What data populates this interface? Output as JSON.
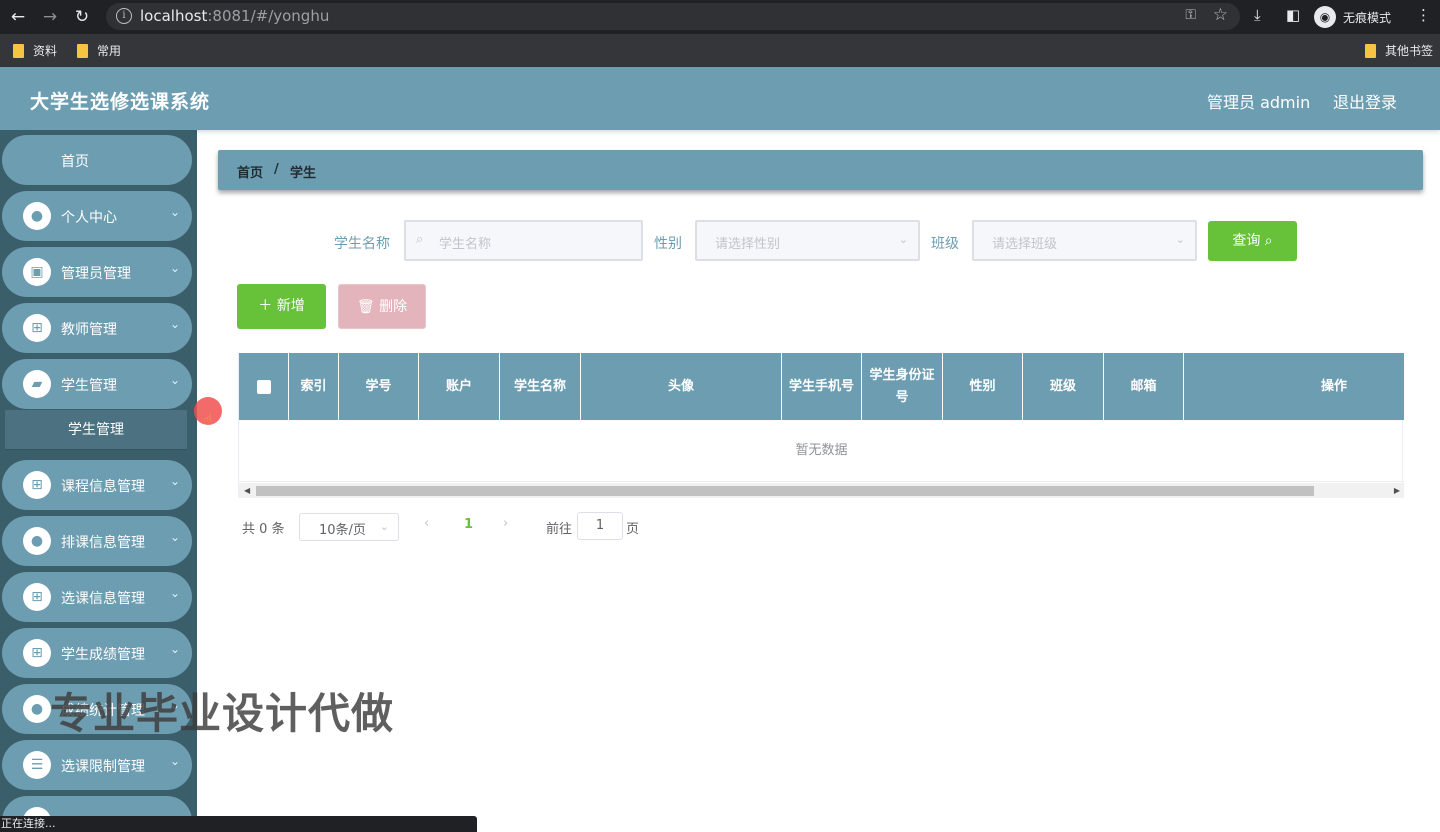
{
  "browser": {
    "url_host": "localhost",
    "url_rest": ":8081/#/yonghu",
    "incognito_label": "无痕模式",
    "bookmarks": [
      "资料",
      "常用"
    ],
    "other_bookmarks": "其他书签",
    "status_text": "正在连接..."
  },
  "header": {
    "title": "大学生选修选课系统",
    "admin_label": "管理员 admin",
    "logout_label": "退出登录"
  },
  "sidebar": {
    "home": "首页",
    "items": [
      {
        "label": "个人中心",
        "icon": "user-icon"
      },
      {
        "label": "管理员管理",
        "icon": "clipboard-icon"
      },
      {
        "label": "教师管理",
        "icon": "grid-icon"
      },
      {
        "label": "学生管理",
        "icon": "wallet-icon"
      },
      {
        "label": "课程信息管理",
        "icon": "grid-icon"
      },
      {
        "label": "排课信息管理",
        "icon": "user-icon"
      },
      {
        "label": "选课信息管理",
        "icon": "grid-icon"
      },
      {
        "label": "学生成绩管理",
        "icon": "grid-icon"
      },
      {
        "label": "成绩统计管理",
        "icon": "bulb-icon"
      },
      {
        "label": "选课限制管理",
        "icon": "list-icon"
      }
    ],
    "submenu_label": "学生管理"
  },
  "breadcrumb": {
    "home": "首页",
    "separator": "/",
    "current": "学生"
  },
  "filters": {
    "name_label": "学生名称",
    "name_placeholder": "学生名称",
    "gender_label": "性别",
    "gender_placeholder": "请选择性别",
    "class_label": "班级",
    "class_placeholder": "请选择班级",
    "query_label": "查询"
  },
  "actions": {
    "add_label": "新增",
    "delete_label": "删除"
  },
  "table": {
    "columns": [
      "索引",
      "学号",
      "账户",
      "学生名称",
      "头像",
      "学生手机号",
      "学生身份证号",
      "性别",
      "班级",
      "邮箱",
      "操作"
    ],
    "empty_text": "暂无数据"
  },
  "pagination": {
    "total_text": "共 0 条",
    "page_size": "10条/页",
    "current_page": "1",
    "goto_label": "前往",
    "goto_value": "1",
    "page_suffix": "页"
  },
  "watermark": "专业毕业设计代做",
  "colors": {
    "primary": "#6d9db1",
    "sidebar_bg": "#3b5e6b",
    "success": "#67c23a",
    "danger_disabled": "#e3b4bb"
  }
}
